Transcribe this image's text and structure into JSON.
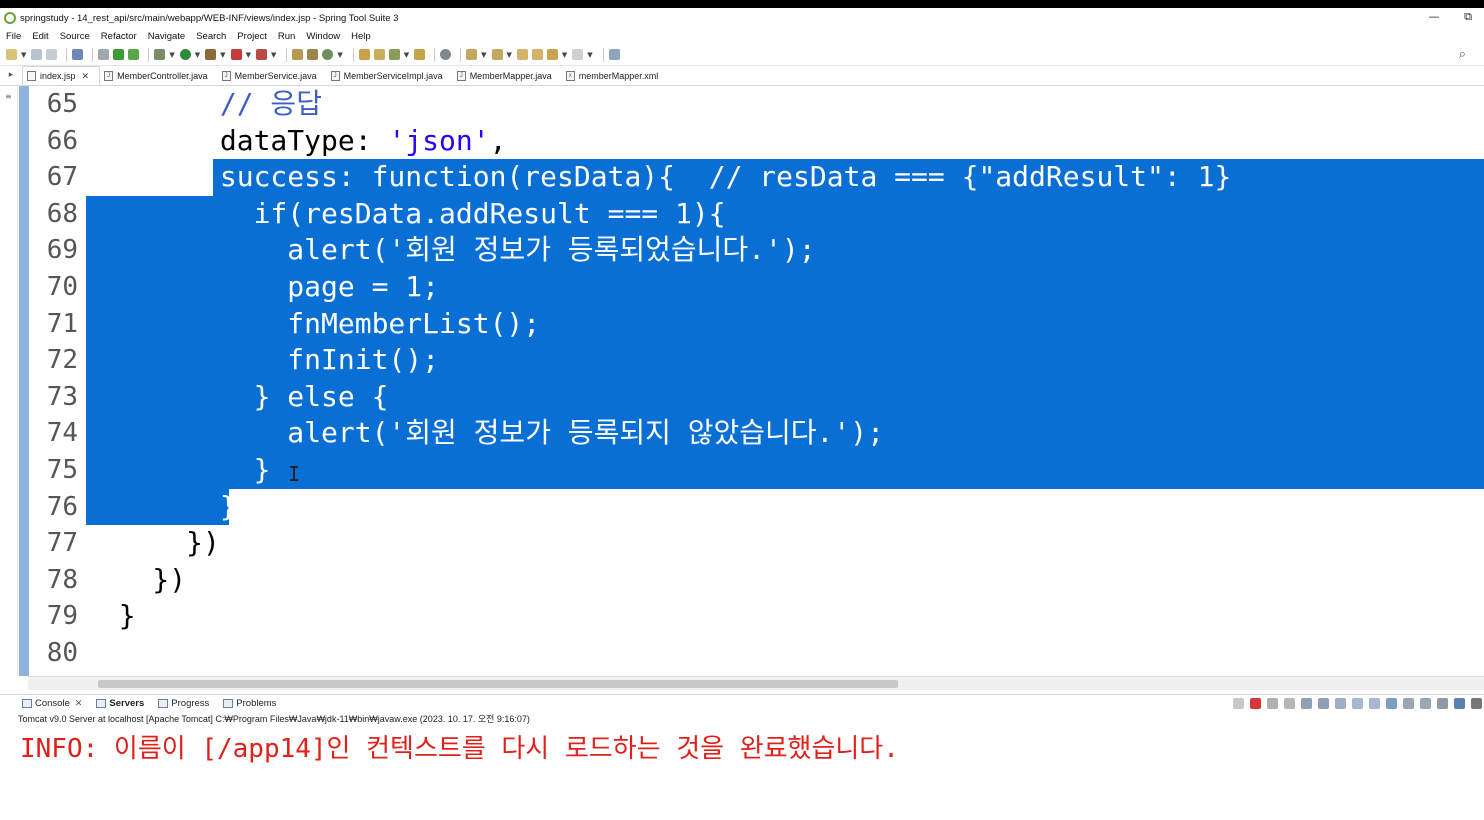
{
  "window": {
    "title": "springstudy - 14_rest_api/src/main/webapp/WEB-INF/views/index.jsp - Spring Tool Suite 3",
    "minimize": "—",
    "maximize": "⧉"
  },
  "menu": [
    "File",
    "Edit",
    "Source",
    "Refactor",
    "Navigate",
    "Search",
    "Project",
    "Run",
    "Window",
    "Help"
  ],
  "tabs": [
    {
      "label": "index.jsp",
      "icon": "jsp-file-icon",
      "active": true,
      "close": "✕"
    },
    {
      "label": "MemberController.java",
      "icon": "java-file-icon",
      "active": false
    },
    {
      "label": "MemberService.java",
      "icon": "java-file-icon",
      "active": false
    },
    {
      "label": "MemberServiceImpl.java",
      "icon": "java-file-icon",
      "active": false
    },
    {
      "label": "MemberMapper.java",
      "icon": "java-file-icon",
      "active": false
    },
    {
      "label": "memberMapper.xml",
      "icon": "xml-file-icon",
      "active": false
    }
  ],
  "editor": {
    "lines": [
      {
        "num": "65",
        "text": "        // 응답"
      },
      {
        "num": "66",
        "text": "        dataType: 'json',"
      },
      {
        "num": "67",
        "text": "        success: function(resData){  // resData === {\"addResult\": 1}"
      },
      {
        "num": "68",
        "text": "          if(resData.addResult === 1){"
      },
      {
        "num": "69",
        "text": "            alert('회원 정보가 등록되었습니다.');"
      },
      {
        "num": "70",
        "text": "            page = 1;"
      },
      {
        "num": "71",
        "text": "            fnMemberList();"
      },
      {
        "num": "72",
        "text": "            fnInit();"
      },
      {
        "num": "73",
        "text": "          } else {"
      },
      {
        "num": "74",
        "text": "            alert('회원 정보가 등록되지 않았습니다.');"
      },
      {
        "num": "75",
        "text": "          }"
      },
      {
        "num": "76",
        "text": "        }"
      },
      {
        "num": "77",
        "text": "      })"
      },
      {
        "num": "78",
        "text": "    })"
      },
      {
        "num": "79",
        "text": "  }"
      },
      {
        "num": "80",
        "text": ""
      }
    ],
    "cursor_glyph": "I"
  },
  "console": {
    "tabs": [
      {
        "label": "Console",
        "close": "✕"
      },
      {
        "label": "Servers"
      },
      {
        "label": "Progress"
      },
      {
        "label": "Problems"
      }
    ],
    "info": "Tomcat v9.0 Server at localhost [Apache Tomcat] C:₩Program Files₩Java₩jdk-11₩bin₩javaw.exe  (2023. 10. 17. 오전 9:16:07)",
    "output": "INFO: 이름이 [/app14]인 컨텍스트를 다시 로드하는 것을 완료했습니다."
  },
  "colors": {
    "selection": "#0a6fd4",
    "comment": "#3f5fbf",
    "string": "#2a00ff",
    "console_error": "#e0201a",
    "overview_bar": "#8db4e0"
  }
}
